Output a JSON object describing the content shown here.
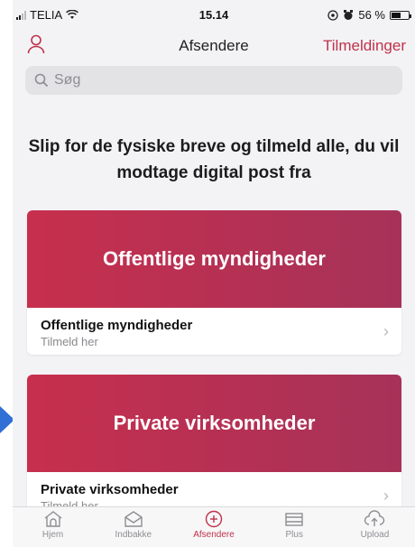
{
  "status_bar": {
    "carrier": "TELIA",
    "time": "15.14",
    "battery_text": "56 %",
    "battery_level": 0.56
  },
  "nav": {
    "title": "Afsendere",
    "action": "Tilmeldinger"
  },
  "search": {
    "placeholder": "Søg"
  },
  "heading": "Slip for de fysiske breve og tilmeld alle, du vil modtage digital post fra",
  "cards": [
    {
      "banner": "Offentlige myndigheder",
      "title": "Offentlige myndigheder",
      "subtitle": "Tilmeld her"
    },
    {
      "banner": "Private virksomheder",
      "title": "Private virksomheder",
      "subtitle": "Tilmeld her"
    }
  ],
  "tabs": [
    {
      "label": "Hjem",
      "icon": "home-icon"
    },
    {
      "label": "Indbakke",
      "icon": "inbox-icon"
    },
    {
      "label": "Afsendere",
      "icon": "add-circle-icon",
      "active": true
    },
    {
      "label": "Plus",
      "icon": "plus-stack-icon"
    },
    {
      "label": "Upload",
      "icon": "cloud-upload-icon"
    }
  ],
  "colors": {
    "accent": "#c0324a",
    "banner_start": "#c72f4d",
    "banner_end": "#a63259",
    "background": "#f3f3f5"
  }
}
